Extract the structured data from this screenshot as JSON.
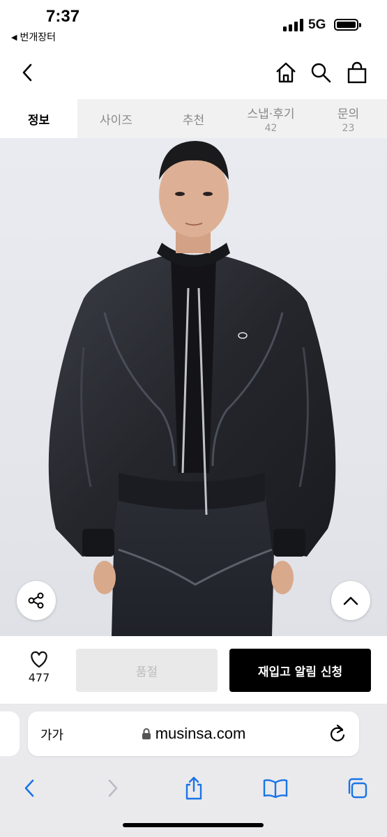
{
  "status_bar": {
    "time": "7:37",
    "back_app": "번개장터",
    "network": "5G"
  },
  "header": {
    "icons": [
      "chevron-left-icon",
      "home-icon",
      "search-icon",
      "shopping-bag-icon"
    ]
  },
  "tabs": [
    {
      "label": "정보",
      "count": "",
      "active": true
    },
    {
      "label": "사이즈",
      "count": ""
    },
    {
      "label": "추천",
      "count": ""
    },
    {
      "label": "스냅·후기",
      "count": "42"
    },
    {
      "label": "문의",
      "count": "23"
    }
  ],
  "product": {
    "share_icon": "share-icon",
    "scroll_top_icon": "chevron-up-icon"
  },
  "action_bar": {
    "like_count": "477",
    "soldout_label": "품절",
    "notify_label": "재입고 알림 신청",
    "colors": {
      "notify_bg": "#000000",
      "soldout_bg": "#e9e9e9"
    }
  },
  "browser": {
    "text_size_label": "가가",
    "domain": "musinsa.com",
    "nav_icons": [
      "back-icon",
      "forward-icon",
      "share-icon",
      "bookmarks-icon",
      "tabs-icon"
    ],
    "accent": "#1a73e8"
  }
}
